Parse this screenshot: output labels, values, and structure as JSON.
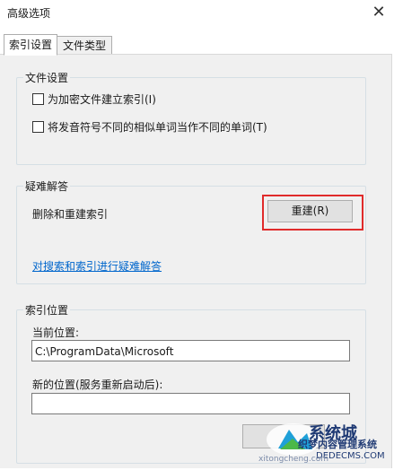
{
  "window": {
    "title": "高级选项",
    "close_glyph": "✕"
  },
  "tabs": [
    {
      "label": "索引设置",
      "active": true
    },
    {
      "label": "文件类型",
      "active": false
    }
  ],
  "file_settings": {
    "legend": "文件设置",
    "options": [
      {
        "label": "为加密文件建立索引(I)",
        "checked": false
      },
      {
        "label": "将发音符号不同的相似单词当作不同的单词(T)",
        "checked": false
      }
    ]
  },
  "troubleshooting": {
    "legend": "疑难解答",
    "rebuild_label": "删除和重建索引",
    "rebuild_button": "重建(R)",
    "help_link": "对搜索和索引进行疑难解答"
  },
  "index_location": {
    "legend": "索引位置",
    "current_label": "当前位置:",
    "current_value": "C:\\ProgramData\\Microsoft",
    "new_label": "新的位置(服务重新启动后):",
    "new_value": ""
  },
  "watermark": {
    "logo_text": "系统城",
    "site_text": "织梦内容管理系统",
    "domain_text": "DEDECMS.COM",
    "url_text": "xitongcheng.com"
  }
}
